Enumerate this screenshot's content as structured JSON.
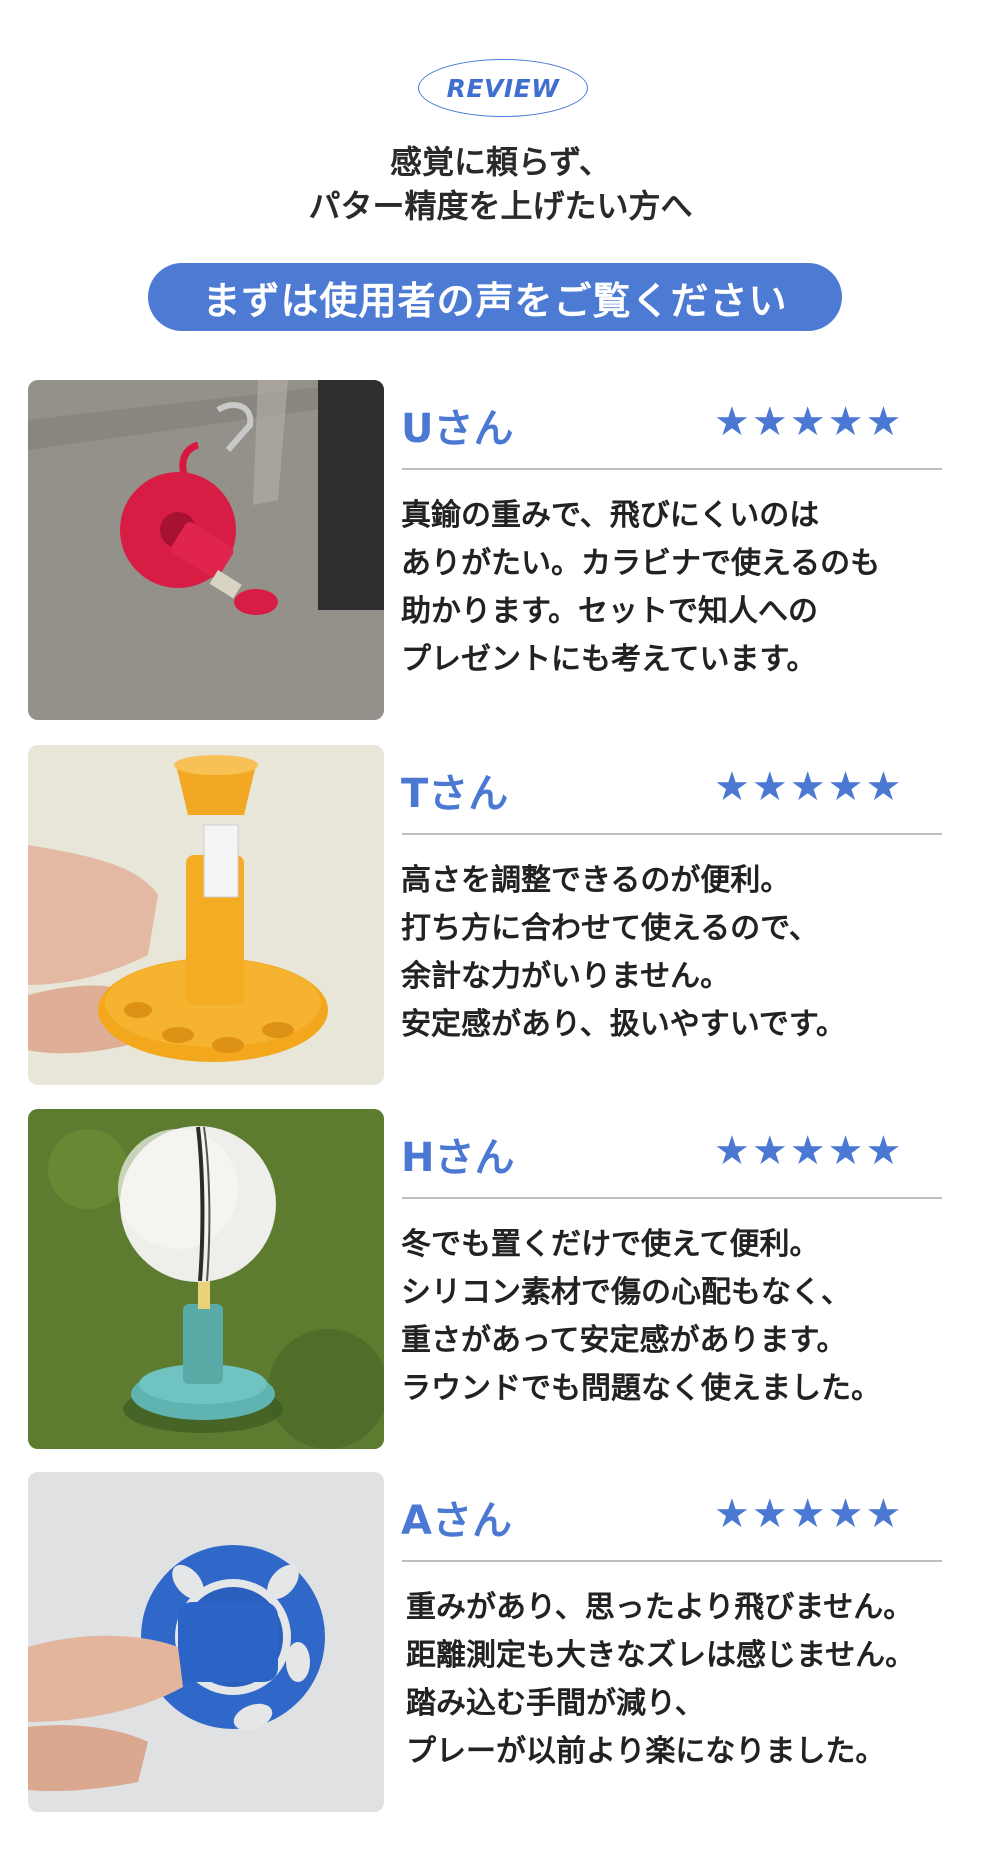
{
  "header": {
    "badge": "REVIEW",
    "headline_line1": "感覚に頼らず、",
    "headline_line2": "パター精度を上げたい方へ",
    "banner": "まずは使用者の声をご覧ください"
  },
  "colors": {
    "accent": "#4a78d2",
    "text": "#222222",
    "rule": "#bfbfbf"
  },
  "reviews": [
    {
      "name": "Uさん",
      "rating": 5,
      "stars": "★★★★★",
      "photo_icon": "red-putting-tee-on-carabiner-photo",
      "lines": [
        "真鍮の重みで、飛びにくいのは",
        "ありがたい。カラビナで使えるのも",
        "助かります。セットで知人への",
        "プレゼントにも考えています。"
      ]
    },
    {
      "name": "Tさん",
      "rating": 5,
      "stars": "★★★★★",
      "photo_icon": "orange-adjustable-tee-in-hand-photo",
      "lines": [
        "高さを調整できるのが便利。",
        "打ち方に合わせて使えるので、",
        "余計な力がいりません。",
        "安定感があり、扱いやすいです。"
      ]
    },
    {
      "name": "Hさん",
      "rating": 5,
      "stars": "★★★★★",
      "photo_icon": "golf-ball-on-teal-tee-photo",
      "lines": [
        "冬でも置くだけで使えて便利。",
        "シリコン素材で傷の心配もなく、",
        "重さがあって安定感があります。",
        "ラウンドでも問題なく使えました。"
      ]
    },
    {
      "name": "Aさん",
      "rating": 5,
      "stars": "★★★★★",
      "photo_icon": "blue-tee-base-in-hand-photo",
      "lines": [
        "重みがあり、思ったより飛びません。",
        "距離測定も大きなズレは感じません。",
        "踏み込む手間が減り、",
        "プレーが以前より楽になりました。"
      ]
    }
  ]
}
